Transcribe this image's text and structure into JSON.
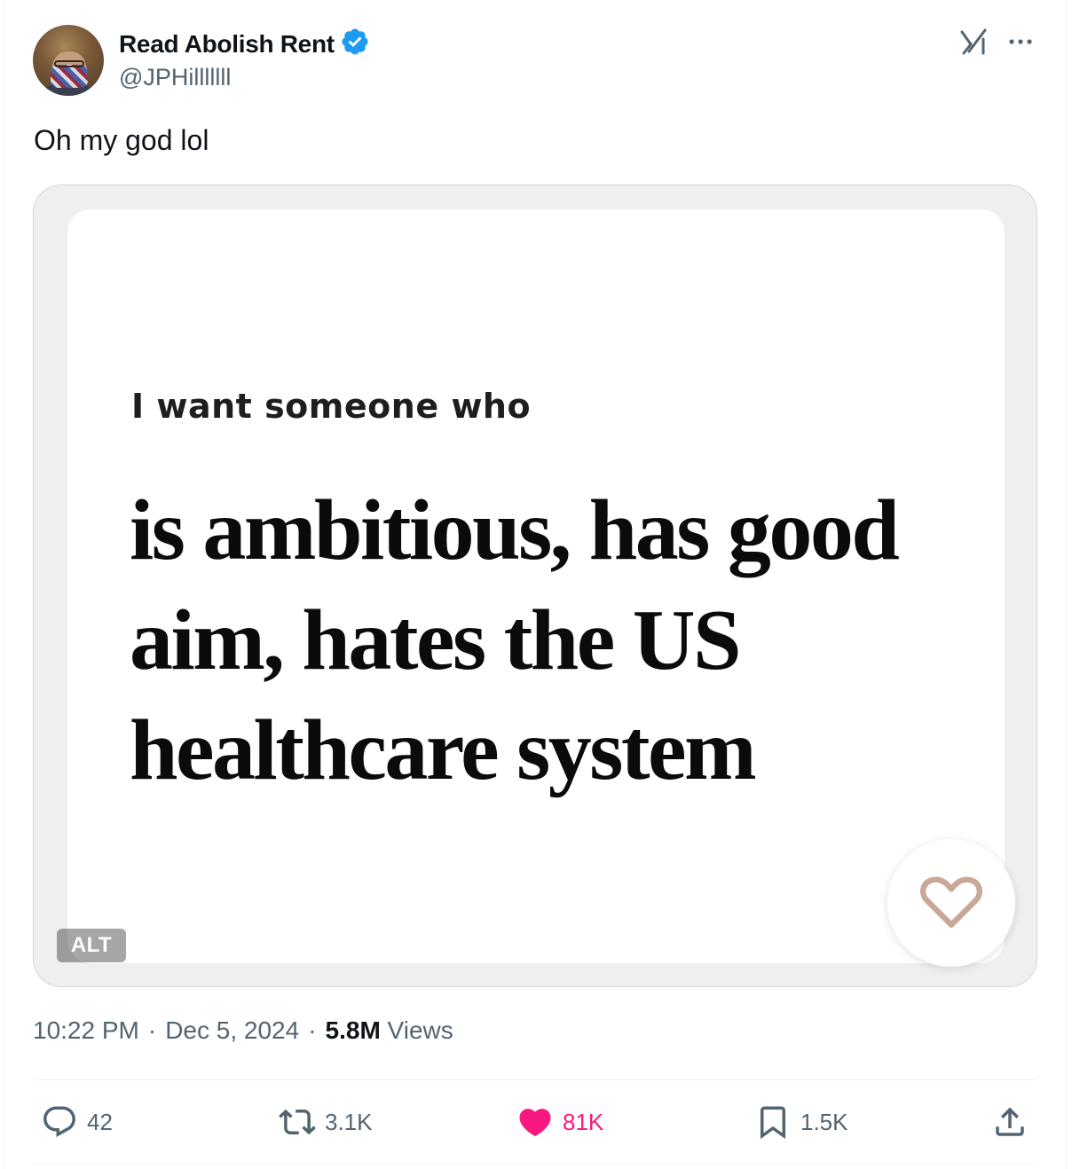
{
  "author": {
    "display_name": "Read Abolish Rent",
    "handle": "@JPHilllllll",
    "verified": true
  },
  "tweet": {
    "text": "Oh my god lol"
  },
  "media": {
    "lead": "I want someone who",
    "headline": "is ambitious, has good aim, hates the US healthcare system",
    "alt_badge": "ALT"
  },
  "meta": {
    "time": "10:22 PM",
    "separator": "·",
    "date": "Dec 5, 2024",
    "views_count": "5.8M",
    "views_label": "Views"
  },
  "actions": {
    "replies": "42",
    "reposts": "3.1K",
    "likes": "81K",
    "bookmarks": "1.5K"
  },
  "colors": {
    "verified_blue": "#1d9bf0",
    "like_pink": "#f91880",
    "secondary_text": "#536471",
    "heart_outline": "#c8a898"
  },
  "icons": {
    "verified": "verified-badge-icon",
    "grok": "grok-icon",
    "more": "more-options-icon",
    "reply": "reply-icon",
    "repost": "repost-icon",
    "like": "like-heart-icon",
    "bookmark": "bookmark-icon",
    "share": "share-icon"
  }
}
